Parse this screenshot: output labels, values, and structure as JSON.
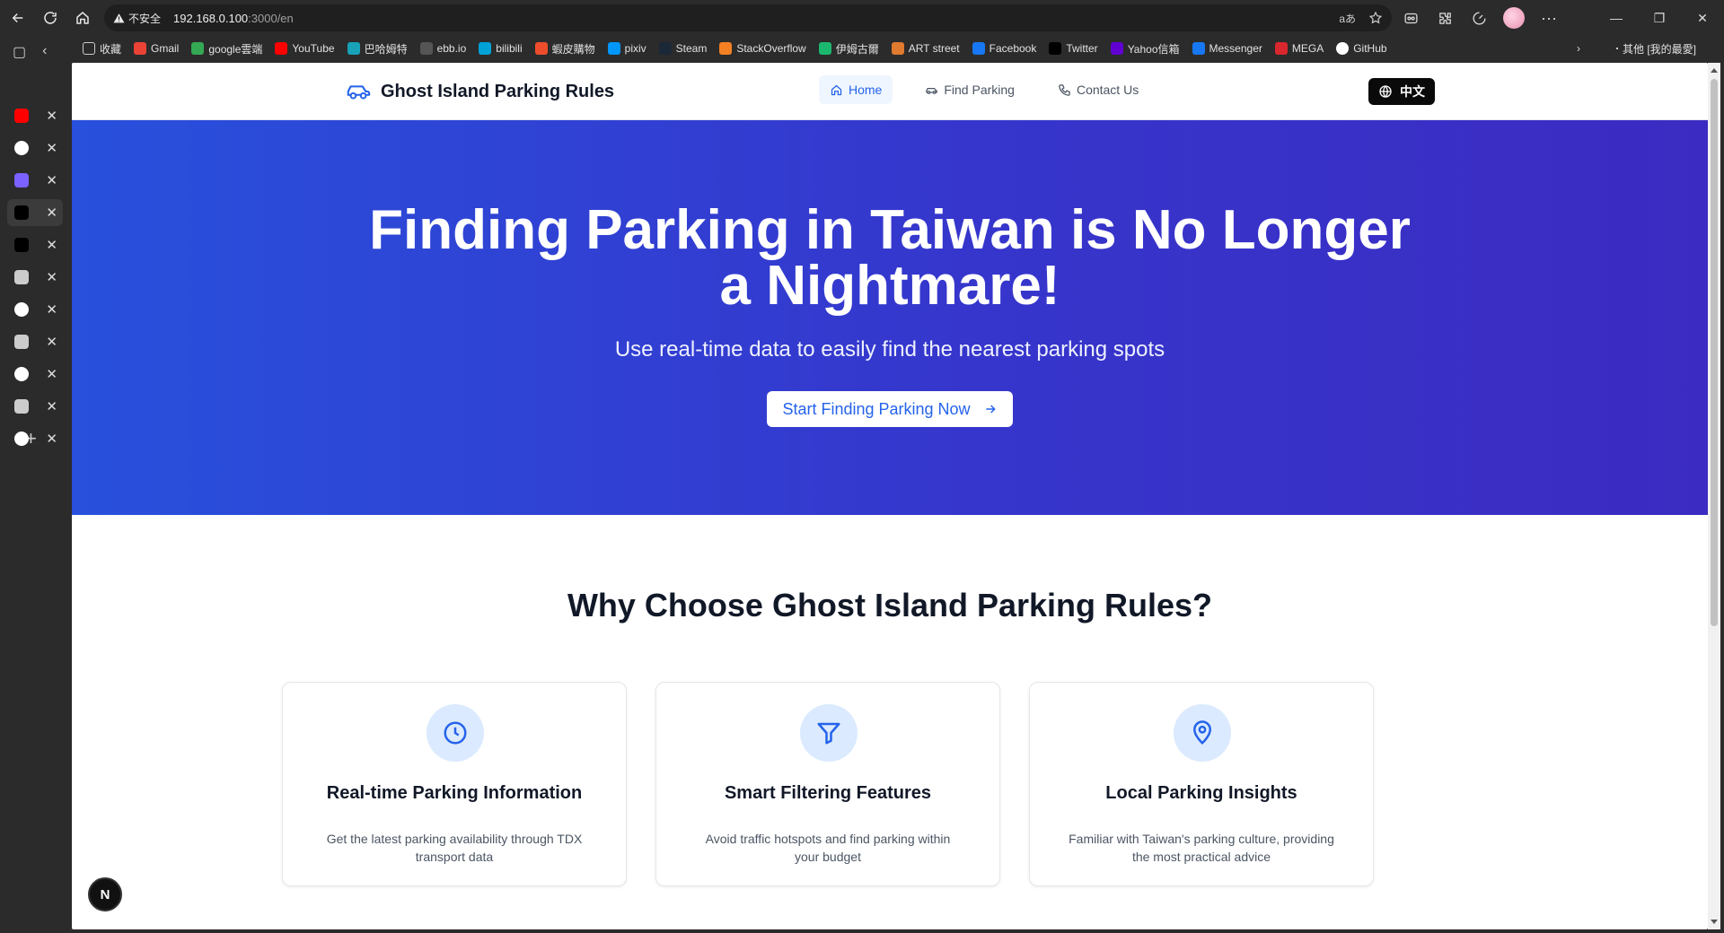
{
  "browser": {
    "url_warning": "不安全",
    "url_host": "192.168.0.100",
    "url_path": ":3000/en",
    "bookmarks": [
      {
        "label": "收藏",
        "icon": "folder-icon",
        "color": "#cccccc"
      },
      {
        "label": "Gmail",
        "icon": "gmail-icon",
        "color": "#ea4335"
      },
      {
        "label": "google雲端",
        "icon": "google-drive-icon",
        "color": "#34a853"
      },
      {
        "label": "YouTube",
        "icon": "youtube-icon",
        "color": "#ff0000"
      },
      {
        "label": "巴哈姆特",
        "icon": "bahamut-icon",
        "color": "#17a2b8"
      },
      {
        "label": "ebb.io",
        "icon": "ebb-icon",
        "color": "#555555"
      },
      {
        "label": "bilibili",
        "icon": "bilibili-icon",
        "color": "#00a1d6"
      },
      {
        "label": "蝦皮購物",
        "icon": "shopee-icon",
        "color": "#ee4d2d"
      },
      {
        "label": "pixiv",
        "icon": "pixiv-icon",
        "color": "#0096fa"
      },
      {
        "label": "Steam",
        "icon": "steam-icon",
        "color": "#1b2838"
      },
      {
        "label": "StackOverflow",
        "icon": "stackoverflow-icon",
        "color": "#f48024"
      },
      {
        "label": "伊姆古爾",
        "icon": "imgur-icon",
        "color": "#1bb76e"
      },
      {
        "label": "ART street",
        "icon": "art-street-icon",
        "color": "#e07a2e"
      },
      {
        "label": "Facebook",
        "icon": "facebook-icon",
        "color": "#1877f2"
      },
      {
        "label": "Twitter",
        "icon": "x-icon",
        "color": "#000000"
      },
      {
        "label": "Yahoo信箱",
        "icon": "yahoo-icon",
        "color": "#6001d2"
      },
      {
        "label": "Messenger",
        "icon": "facebook-icon",
        "color": "#1877f2"
      },
      {
        "label": "MEGA",
        "icon": "mega-icon",
        "color": "#d9272e"
      },
      {
        "label": "GitHub",
        "icon": "github-icon",
        "color": "#ffffff"
      }
    ],
    "other_bookmarks": "其他 [我的最愛]",
    "tabs": [
      {
        "icon": "youtube-icon",
        "color": "#ff0000",
        "active": false
      },
      {
        "icon": "github-icon",
        "color": "#ffffff",
        "active": false
      },
      {
        "icon": "copilot-icon",
        "color": "#7b61ff",
        "active": false
      },
      {
        "icon": "vercel-icon",
        "color": "#000000",
        "active": true
      },
      {
        "icon": "vercel-icon",
        "color": "#000000",
        "active": false
      },
      {
        "icon": "document-icon",
        "color": "#cccccc",
        "active": false
      },
      {
        "icon": "github-icon",
        "color": "#ffffff",
        "active": false
      },
      {
        "icon": "calendar-icon",
        "color": "#cccccc",
        "active": false
      },
      {
        "icon": "google-icon",
        "color": "#ffffff",
        "active": false
      },
      {
        "icon": "calendar-icon",
        "color": "#cccccc",
        "active": false
      },
      {
        "icon": "google-icon",
        "color": "#ffffff",
        "active": false
      }
    ]
  },
  "site": {
    "brand": "Ghost Island Parking Rules",
    "nav": {
      "home": "Home",
      "find_parking": "Find Parking",
      "contact": "Contact Us"
    },
    "lang_toggle": "中文",
    "hero": {
      "title": "Finding Parking in Taiwan is No Longer a Nightmare!",
      "subtitle": "Use real-time data to easily find the nearest parking spots",
      "cta": "Start Finding Parking Now"
    },
    "why_title": "Why Choose Ghost Island Parking Rules?",
    "features": [
      {
        "icon": "clock-icon",
        "title": "Real-time Parking Information",
        "desc": "Get the latest parking availability through TDX transport data"
      },
      {
        "icon": "filter-icon",
        "title": "Smart Filtering Features",
        "desc": "Avoid traffic hotspots and find parking within your budget"
      },
      {
        "icon": "map-pin-icon",
        "title": "Local Parking Insights",
        "desc": "Familiar with Taiwan's parking culture, providing the most practical advice"
      }
    ],
    "dev_badge": "N"
  },
  "colors": {
    "hero_start": "#2850dc",
    "hero_end": "#3b2bc2",
    "accent": "#2563eb"
  }
}
